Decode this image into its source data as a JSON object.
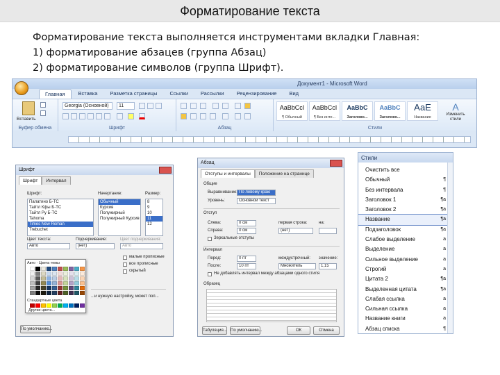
{
  "slide": {
    "title": "Форматирование текста",
    "lines": [
      "Форматирование текста  выполняется инструментами вкладки Главная:",
      "1)  форматирование абзацев (группа Абзац)",
      "2)  форматирование символов (группа Шрифт)."
    ]
  },
  "ribbon": {
    "window_title": "Документ1 - Microsoft Word",
    "tabs": [
      "Главная",
      "Вставка",
      "Разметка страницы",
      "Ссылки",
      "Рассылки",
      "Рецензирование",
      "Вид"
    ],
    "active_tab": "Главная",
    "paste_label": "Вставить",
    "font_name": "Georgia (Основной)",
    "font_size": "11",
    "groups": [
      "Буфер обмена",
      "Шрифт",
      "Абзац",
      "Стили"
    ],
    "style_gallery": [
      {
        "sample": "AaBbCcI",
        "name": "¶ Обычный"
      },
      {
        "sample": "AaBbCcI",
        "name": "¶ Без инте..."
      },
      {
        "sample": "AaBbC",
        "name": "Заголово..."
      },
      {
        "sample": "AaBbC",
        "name": "Заголово..."
      },
      {
        "sample": "АаЕ",
        "name": "Название"
      }
    ],
    "change_styles": "Изменить стили"
  },
  "font_dialog": {
    "title": "Шрифт",
    "tabs": [
      "Шрифт",
      "Интервал"
    ],
    "font_label": "Шрифт:",
    "style_label": "Начертание:",
    "size_label": "Размер:",
    "fonts": [
      "Палатино Б-ТС",
      "Тайтл Кфы Б-ТС",
      "Тайтл Ру Б-ТС",
      "Tahoma",
      "Times New Roman",
      "Trebuchet"
    ],
    "styles": [
      "Обычный",
      "Курсив",
      "Полужирный",
      "Полужирный Курсив"
    ],
    "sizes": [
      "8",
      "9",
      "10",
      "11",
      "12"
    ],
    "color_label": "Цвет текста:",
    "color_value": "Авто",
    "underline_label": "Подчеркивание:",
    "underline_value": "(нет)",
    "underline_color_label": "Цвет подчеркивания:",
    "underline_color_value": "Авто",
    "effects": [
      "малые прописные",
      "все прописные",
      "скрытый"
    ],
    "note": "...и нужную настройку, может пол...",
    "default_button": "По умолчанию..."
  },
  "palette": {
    "header": "Авто",
    "theme_label": "Цвета темы",
    "standard_label": "Стандартные цвета",
    "more_label": "Другие цвета...",
    "columns": [
      "#ffffff",
      "#000000",
      "#eeece1",
      "#1f497d",
      "#4f81bd",
      "#c0504d",
      "#9bbb59",
      "#8064a2",
      "#4bacc6",
      "#f79646"
    ],
    "rows": [
      [
        "#f2f2f2",
        "#7f7f7f",
        "#ddd9c3",
        "#c6d9f0",
        "#dbe5f1",
        "#f2dcdb",
        "#ebf1dd",
        "#e5e0ec",
        "#dbeef3",
        "#fdeada"
      ],
      [
        "#d8d8d8",
        "#595959",
        "#c4bd97",
        "#8db3e2",
        "#b8cce4",
        "#e5b9b7",
        "#d7e3bc",
        "#ccc1d9",
        "#b7dde8",
        "#fbd5b5"
      ],
      [
        "#bfbfbf",
        "#3f3f3f",
        "#938953",
        "#548dd4",
        "#95b3d7",
        "#d99694",
        "#c3d69b",
        "#b2a2c7",
        "#92cddc",
        "#fac08f"
      ],
      [
        "#a5a5a5",
        "#262626",
        "#494429",
        "#17365d",
        "#366092",
        "#953734",
        "#76923c",
        "#5f497a",
        "#31859b",
        "#e36c09"
      ],
      [
        "#7f7f7f",
        "#0c0c0c",
        "#1d1b10",
        "#0f243e",
        "#244061",
        "#632423",
        "#4f6128",
        "#3f3151",
        "#205867",
        "#974806"
      ]
    ],
    "standard": [
      "#c00000",
      "#ff0000",
      "#ffc000",
      "#ffff00",
      "#92d050",
      "#00b050",
      "#00b0f0",
      "#0070c0",
      "#002060",
      "#7030a0"
    ]
  },
  "paragraph_dialog": {
    "title": "Абзац",
    "tabs": [
      "Отступы и интервалы",
      "Положение на странице"
    ],
    "general_label": "Общие",
    "align_label": "Выравнивание:",
    "align_value": "По левому краю",
    "level_label": "Уровень:",
    "level_value": "Основной текст",
    "indent_label": "Отступ",
    "left_label": "Слева:",
    "left_value": "0 см",
    "right_label": "Справа:",
    "right_value": "0 см",
    "first_line_label": "первая строка:",
    "first_line_value": "(нет)",
    "by_label": "на:",
    "mirror_label": "Зеркальные отступы",
    "spacing_label": "Интервал",
    "before_label": "Перед:",
    "before_value": "0 пт",
    "after_label": "После:",
    "after_value": "10 пт",
    "line_spacing_label": "междустрочный:",
    "line_spacing_value": "Множитель",
    "at_label": "значение:",
    "at_value": "1,15",
    "no_space_label": "Не добавлять интервал между абзацами одного стиля",
    "preview_label": "Образец",
    "tabs_button": "Табуляция...",
    "default_button": "По умолчанию...",
    "ok_button": "ОК",
    "cancel_button": "Отмена"
  },
  "styles_pane": {
    "title": "Стили",
    "items": [
      {
        "name": "Очистить все",
        "mark": ""
      },
      {
        "name": "Обычный",
        "mark": "¶"
      },
      {
        "name": "Без интервала",
        "mark": "¶"
      },
      {
        "name": "Заголовок 1",
        "mark": "¶a"
      },
      {
        "name": "Заголовок 2",
        "mark": "¶a"
      },
      {
        "name": "Название",
        "mark": "¶a"
      },
      {
        "name": "Подзаголовок",
        "mark": "¶a"
      },
      {
        "name": "Слабое выделение",
        "mark": "a"
      },
      {
        "name": "Выделение",
        "mark": "a"
      },
      {
        "name": "Сильное выделение",
        "mark": "a"
      },
      {
        "name": "Строгий",
        "mark": "a"
      },
      {
        "name": "Цитата 2",
        "mark": "¶a"
      },
      {
        "name": "Выделенная цитата",
        "mark": "¶a"
      },
      {
        "name": "Слабая ссылка",
        "mark": "a"
      },
      {
        "name": "Сильная ссылка",
        "mark": "a"
      },
      {
        "name": "Название книги",
        "mark": "a"
      },
      {
        "name": "Абзац списка",
        "mark": "¶"
      }
    ],
    "selected_index": 5
  }
}
